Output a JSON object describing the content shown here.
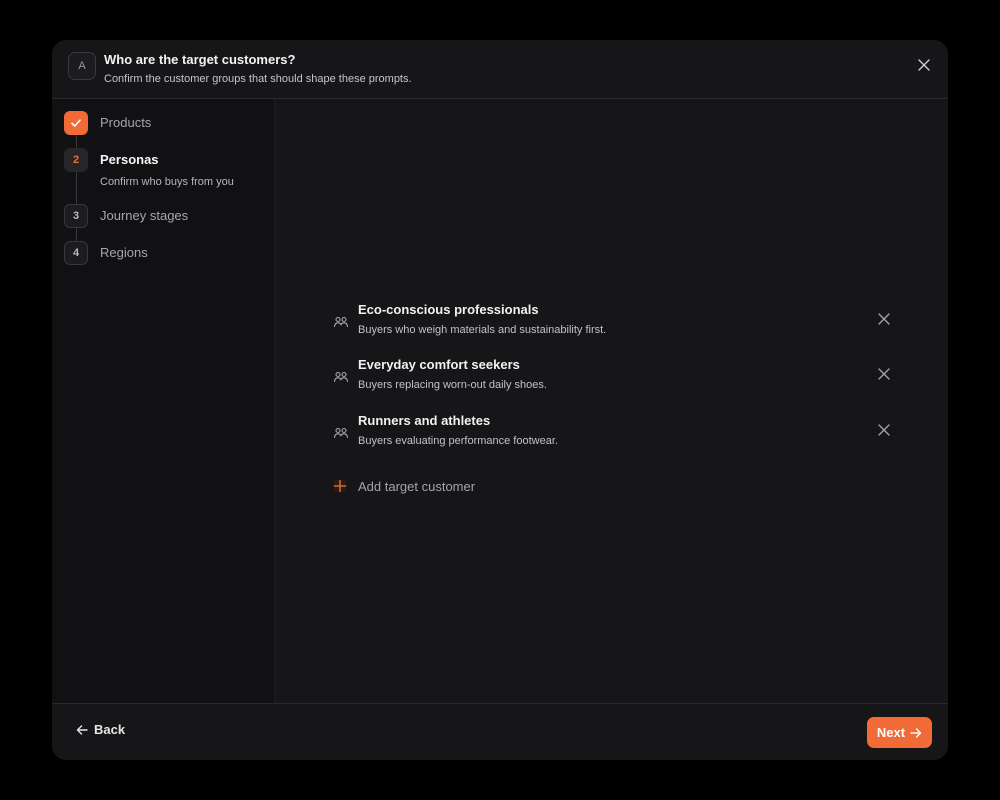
{
  "header": {
    "badge": "A",
    "title": "Who are the target customers?",
    "subtitle": "Confirm the customer groups that should shape these prompts."
  },
  "steps": [
    {
      "number": "",
      "label": "Products",
      "state": "done"
    },
    {
      "number": "2",
      "label": "Personas",
      "sub": "Confirm who buys from you",
      "state": "active"
    },
    {
      "number": "3",
      "label": "Journey stages",
      "state": "pending"
    },
    {
      "number": "4",
      "label": "Regions",
      "state": "pending"
    }
  ],
  "personas": [
    {
      "title": "Eco-conscious professionals",
      "desc": "Buyers who weigh materials and sustainability first."
    },
    {
      "title": "Everyday comfort seekers",
      "desc": "Buyers replacing worn-out daily shoes."
    },
    {
      "title": "Runners and athletes",
      "desc": "Buyers evaluating performance footwear."
    }
  ],
  "add_label": "Add target customer",
  "footer": {
    "back_label": "Back",
    "next_label": "Next"
  },
  "icons": {
    "close": "close-icon",
    "check": "check-icon",
    "persona": "users-icon",
    "remove": "remove-icon",
    "add": "plus-icon",
    "back": "arrow-left-icon",
    "next": "arrow-right-icon"
  },
  "colors": {
    "accent": "#f26a36",
    "background": "#000000",
    "panel": "#161618",
    "sidebar": "#111113"
  }
}
